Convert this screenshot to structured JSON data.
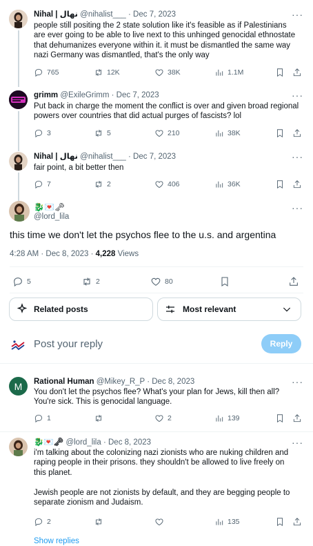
{
  "tweets": [
    {
      "name": "Nihal | نهال",
      "handle": "@nihalist___",
      "date": "· Dec 7, 2023",
      "more": "···",
      "lines": [
        "people still positing the 2 state solution like it's feasible as if Palestinians",
        "are ever going to be able to live next to this unhinged genocidal ethnostate",
        "that dehumanizes everyone within it. it must be dismantled the same way",
        "nazi Germany was dismantled, that's the only way"
      ],
      "replies": "765",
      "retweets": "12K",
      "likes": "38K",
      "views": "1.1M"
    },
    {
      "name": "grimm",
      "handle": "@ExileGrimm",
      "date": "· Dec 7, 2023",
      "more": "···",
      "lines": [
        "Put back in charge the moment the conflict is over and given broad regional",
        "powers over countries that did actual purges of fascists? lol"
      ],
      "replies": "3",
      "retweets": "5",
      "likes": "210",
      "views": "38K"
    },
    {
      "name": "Nihal | نهال",
      "handle": "@nihalist___",
      "date": "· Dec 7, 2023",
      "more": "···",
      "lines": [
        "fair point, a bit better then"
      ],
      "replies": "7",
      "retweets": "2",
      "likes": "406",
      "views": "36K"
    }
  ],
  "main": {
    "name_emojis": "🐉💌🗝",
    "handle": "@lord_lila",
    "more": "···",
    "text": "this time we don't let the psychos flee to the u.s. and argentina",
    "time": "4:28 AM · Dec 8, 2023 · ",
    "views_count": "4,228",
    "views_label": " Views",
    "replies": "5",
    "retweets": "2",
    "likes": "80"
  },
  "filters": {
    "related": "Related posts",
    "relevance": "Most relevant"
  },
  "composer": {
    "placeholder": "Post your reply",
    "button": "Reply"
  },
  "replies": [
    {
      "avatar_letter": "M",
      "name": "Rational Human",
      "handle": "@Mikey_R_P",
      "date": "· Dec 8, 2023",
      "more": "···",
      "lines": [
        "You don't let the psychos flee? What's your plan for Jews, kill then all?",
        "You're sick. This is genocidal language."
      ],
      "replies": "1",
      "retweets": "",
      "likes": "2",
      "views": "139"
    },
    {
      "name": "🐉💌🗝",
      "handle": "@lord_lila",
      "date": "· Dec 8, 2023",
      "more": "···",
      "lines": [
        "i'm talking about the colonizing nazi zionists who are nuking children and",
        "raping people in their prisons. they shouldn't be allowed to live freely on",
        "this planet.",
        "",
        "Jewish people are not zionists by default, and they are begging people to",
        "separate zionism and Judaism."
      ],
      "replies": "2",
      "retweets": "",
      "likes": "",
      "views": "135"
    }
  ],
  "show_replies": "Show replies",
  "colors": {
    "accent": "#1d9bf0",
    "reply_button": "#8ecdf8",
    "muted": "#536471"
  }
}
